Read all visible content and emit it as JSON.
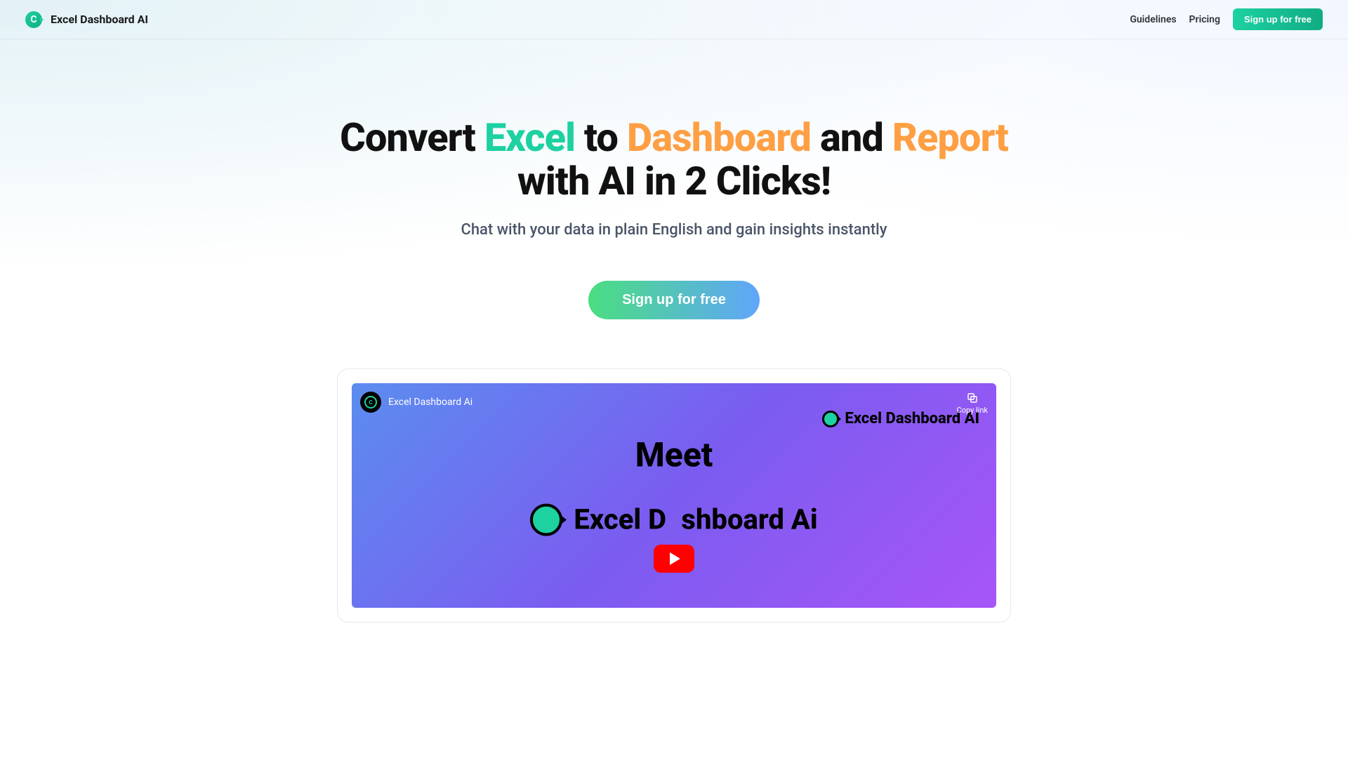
{
  "header": {
    "brand_name": "Excel Dashboard AI",
    "nav": {
      "guidelines": "Guidelines",
      "pricing": "Pricing",
      "cta": "Sign up for free"
    }
  },
  "hero": {
    "title_parts": {
      "p1": "Convert ",
      "p2": "Excel",
      "p3": " to ",
      "p4": "Dashboard",
      "p5": " and ",
      "p6": "Report",
      "p7": "with AI in 2 Clicks!"
    },
    "subtitle": "Chat with your data in plain English and gain insights instantly",
    "cta": "Sign up for free"
  },
  "video": {
    "title": "Excel Dashboard Ai",
    "copy_link": "Copy link",
    "watermark": "Excel Dashboard AI",
    "meet": "Meet",
    "product_part1": "Excel D",
    "product_part2": "shboard Ai"
  }
}
